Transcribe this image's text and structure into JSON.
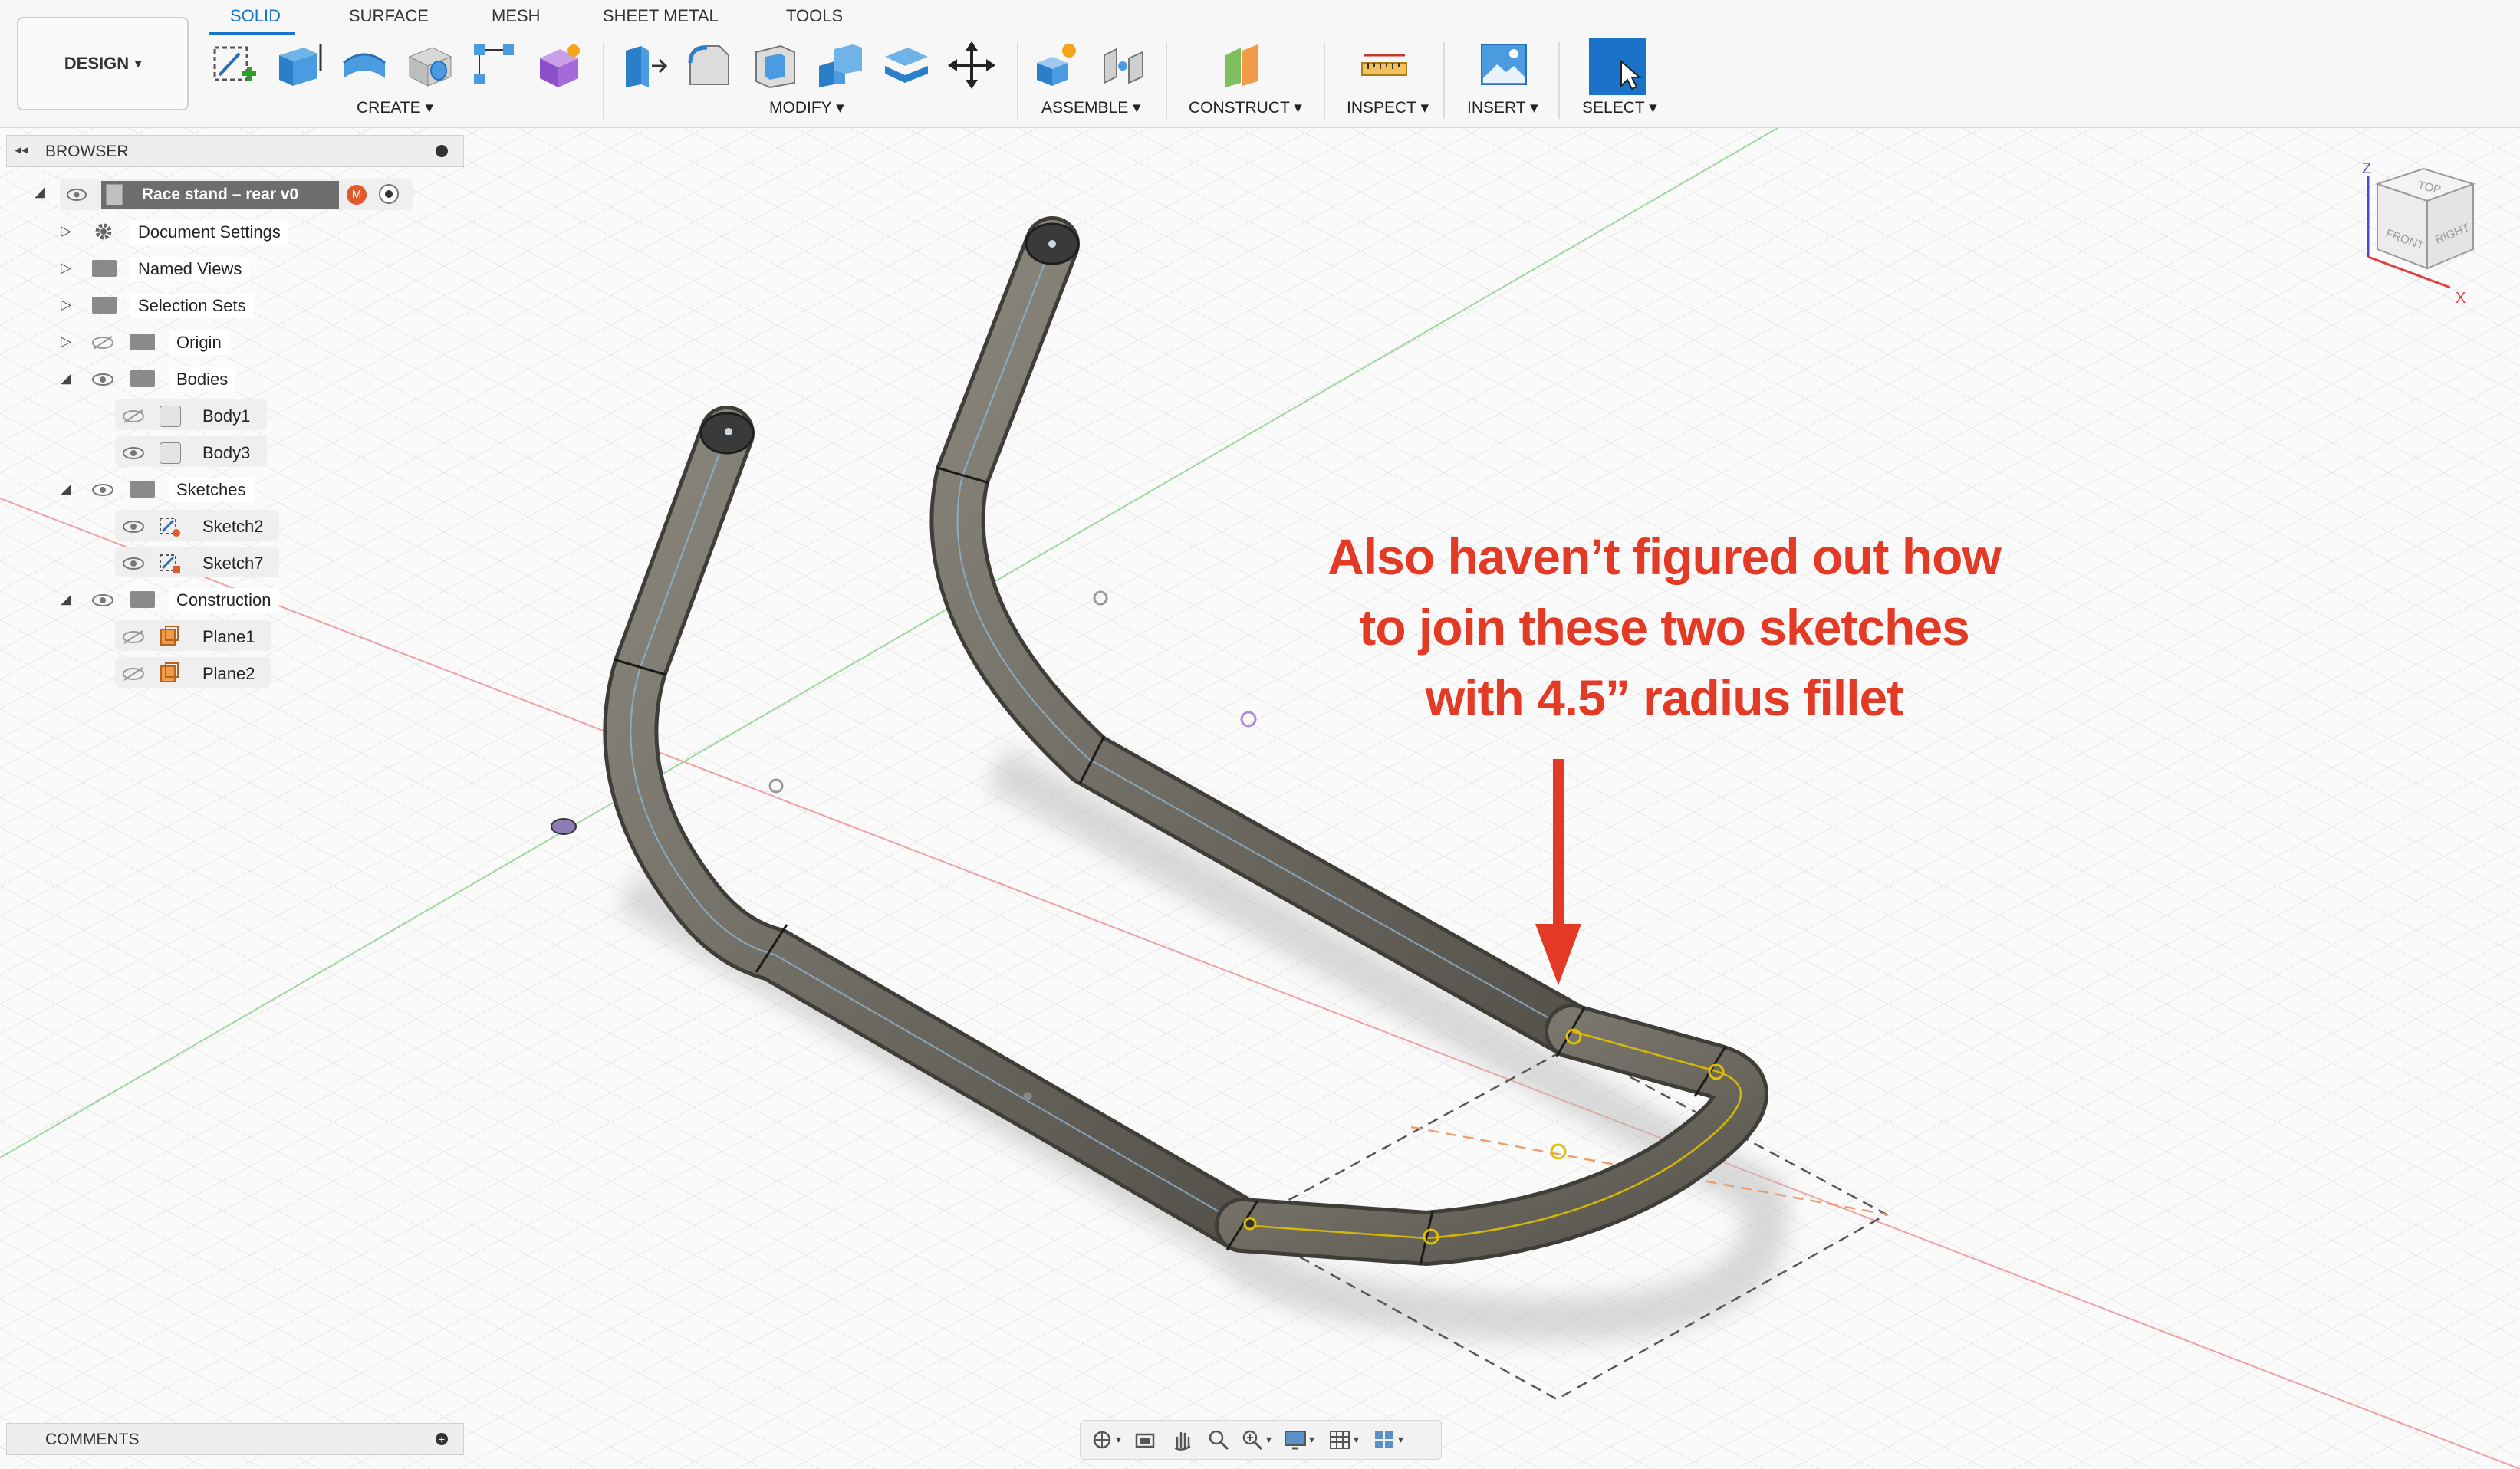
{
  "workspace": {
    "label": "DESIGN"
  },
  "tabs": [
    {
      "label": "SOLID",
      "active": true
    },
    {
      "label": "SURFACE"
    },
    {
      "label": "MESH"
    },
    {
      "label": "SHEET METAL"
    },
    {
      "label": "TOOLS"
    }
  ],
  "groups": {
    "create": "CREATE ▾",
    "modify": "MODIFY ▾",
    "assemble": "ASSEMBLE ▾",
    "construct": "CONSTRUCT ▾",
    "inspect": "INSPECT ▾",
    "insert": "INSERT ▾",
    "select": "SELECT ▾"
  },
  "browser": {
    "title": "BROWSER",
    "root": "Race stand – rear v0",
    "items": [
      {
        "label": "Document Settings"
      },
      {
        "label": "Named Views"
      },
      {
        "label": "Selection Sets"
      },
      {
        "label": "Origin"
      },
      {
        "label": "Bodies"
      },
      {
        "label": "Body1"
      },
      {
        "label": "Body3"
      },
      {
        "label": "Sketches"
      },
      {
        "label": "Sketch2"
      },
      {
        "label": "Sketch7"
      },
      {
        "label": "Construction"
      },
      {
        "label": "Plane1"
      },
      {
        "label": "Plane2"
      }
    ]
  },
  "comments": {
    "title": "COMMENTS"
  },
  "annotation": {
    "lines": [
      "Also haven’t figured out how",
      "to join these two sketches",
      "with 4.5” radius fillet"
    ],
    "color": "#e23a25"
  },
  "viewcube": {
    "top": "TOP",
    "front": "FRONT",
    "right": "RIGHT",
    "axis_z": "Z",
    "axis_x": "X"
  },
  "colors": {
    "accent": "#1a73c9",
    "tube": "#6b675e",
    "annotation": "#e23a25",
    "sketch": "#e0c000"
  }
}
